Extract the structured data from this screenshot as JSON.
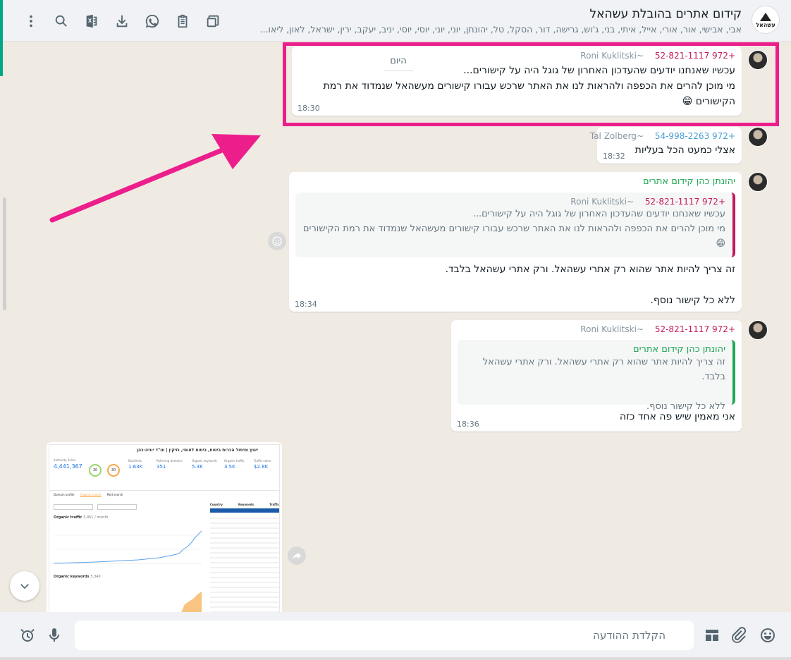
{
  "header": {
    "title": "קידום אתרים בהובלת עשהאל",
    "participants": "אבי, אבישי, אור, אורי, אייל, איתי, בני, ג'וש, גרישה, דור, הסקל, טל, יהונתן, יוני, יוני, יוסי, יוסי, יניב, יעקב, ירין, ישראל, לאון, ליאו...",
    "avatar_text": "עשהאל",
    "icons": [
      "more-vert-icon",
      "search-icon",
      "excel-export-icon",
      "download-icon",
      "whatsapp-icon",
      "clipboard-icon",
      "windows-icon"
    ]
  },
  "date_chip": "היום",
  "messages": [
    {
      "phone": "+972 52-821-1117",
      "name": "~Roni Kuklitski",
      "lines": [
        "עכשיו שאנחנו יודעים שהעדכון האחרון של גוגל היה על קישורים...",
        "מי מוכן להרים את הכפפה ולהראות לנו את האתר שרכש עבורו קישורים מעשהאל שנמדוד את רמת",
        "הקישורים 😁"
      ],
      "time": "18:30"
    },
    {
      "phone": "+972 54-998-2263",
      "name": "~Tal Zolberg",
      "text": "אצלי כמעט הכל בעליות",
      "time": "18:32"
    },
    {
      "sender": "יהונתן כהן קידום אתרים",
      "quote_phone": "+972 52-821-1117",
      "quote_name": "~Roni Kuklitski",
      "quote_lines": [
        "עכשיו שאנחנו יודעים שהעדכון האחרון של גוגל היה על קישורים...",
        "מי מוכן להרים את הכפפה ולהראות לנו את האתר שרכש עבורו קישורים מעשהאל שנמדוד את רמת הקישורים",
        "😁"
      ],
      "lines": [
        "זה צריך להיות אתר שהוא רק אתרי עשהאל. ורק אתרי עשהאל בלבד.",
        "",
        "ללא כל קישור נוסף."
      ],
      "time": "18:34"
    },
    {
      "phone": "+972 52-821-1117",
      "name": "~Roni Kuklitski",
      "quote_sender": "יהונתן כהן קידום אתרים",
      "quote_lines": [
        "זה צריך להיות אתר שהוא רק אתרי עשהאל. ורק אתרי עשהאל בלבד.",
        "",
        "ללא כל קישור נוסף."
      ],
      "text": "אני מאמין שיש פה אחד כזה",
      "time": "18:36"
    }
  ],
  "screenshot_preview": {
    "title": "יעוץ וטיפול הכרות ביטוח, ביטוח לאומי, נזיקין | עו\"ד יוניה-כהן",
    "authority_label": "Authority Score",
    "authority_value": "4,441,367",
    "stats": [
      {
        "label": "Backlinks",
        "value": "1.63K"
      },
      {
        "label": "Referring domains",
        "value": "351"
      },
      {
        "label": "Organic keywords",
        "value": "5.3K"
      },
      {
        "label": "Organic traffic",
        "value": "3.5K"
      },
      {
        "label": "Traffic value",
        "value": "$2.8K"
      }
    ],
    "score_badges": [
      "30",
      "30"
    ],
    "tabs": [
      "Domain profile",
      "Organic search",
      "Paid search"
    ],
    "chart_label": "Organic traffic",
    "chart_sub": "3,451 / month",
    "keywords_label": "Organic keywords",
    "keywords_sub": "5,340",
    "table_headers": [
      "Country",
      "Keywords",
      "Traffic"
    ]
  },
  "compose": {
    "placeholder": "הקלדת ההודעה"
  },
  "footer_icons": [
    "emoji-icon",
    "attach-icon",
    "template-icon",
    "mic-icon",
    "alarm-icon"
  ],
  "colors": {
    "highlight": "#ec1e8c",
    "arrow": "#ec1e8c",
    "phone_pink": "#c2185b",
    "phone_blue": "#4a9fd4",
    "sender_green": "#1fa855",
    "chat_bg": "#efeae2"
  }
}
